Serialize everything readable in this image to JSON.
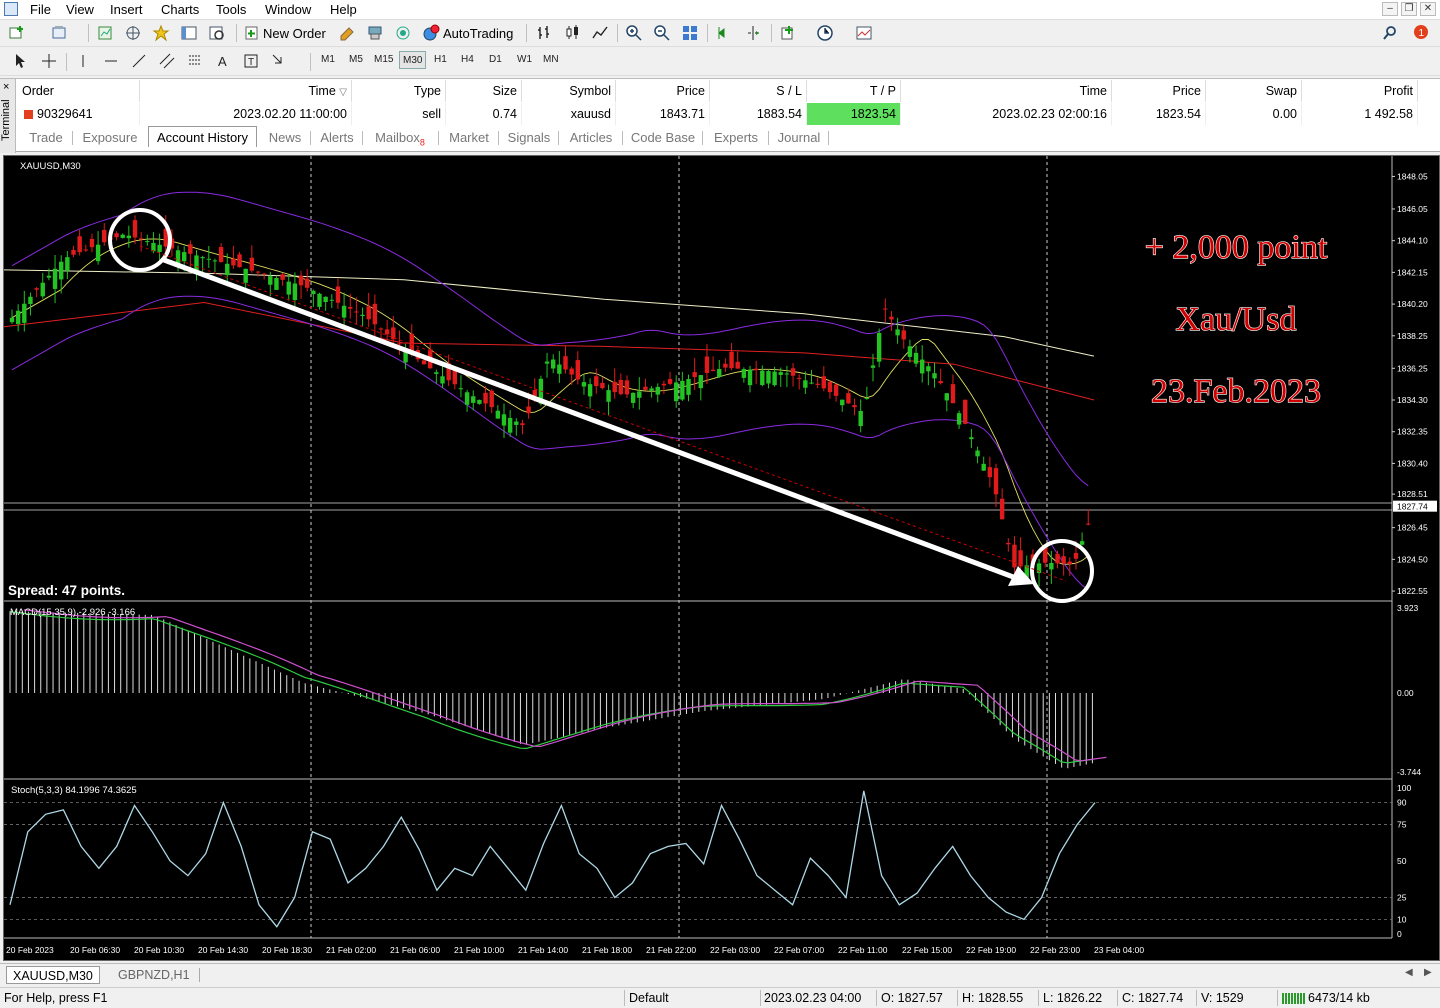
{
  "menu": [
    "File",
    "View",
    "Insert",
    "Charts",
    "Tools",
    "Window",
    "Help"
  ],
  "toolbar": {
    "new_order_label": "New Order",
    "autotrading_label": "AutoTrading"
  },
  "timeframes": [
    "M1",
    "M5",
    "M15",
    "M30",
    "H1",
    "H4",
    "D1",
    "W1",
    "MN"
  ],
  "active_timeframe": "M30",
  "terminal": {
    "side_label": "Terminal",
    "columns": [
      "Order",
      "Time",
      "Type",
      "Size",
      "Symbol",
      "Price",
      "S / L",
      "T / P",
      "Time",
      "Price",
      "Swap",
      "Profit"
    ],
    "row": [
      "90329641",
      "2023.02.20 11:00:00",
      "sell",
      "0.74",
      "xauusd",
      "1843.71",
      "1883.54",
      "1823.54",
      "2023.02.23 02:00:16",
      "1823.54",
      "0.00",
      "1 492.58"
    ],
    "tabs": [
      "Trade",
      "Exposure",
      "Account History",
      "News",
      "Alerts",
      "Mailbox",
      "Market",
      "Signals",
      "Articles",
      "Code Base",
      "Experts",
      "Journal"
    ],
    "active_tab": "Account History",
    "mailbox_badge": "8"
  },
  "chart": {
    "symbol_label": "XAUUSD,M30",
    "spread_label": "Spread: 47 points.",
    "annotation_lines": [
      "+ 2,000 point",
      "Xau/Usd",
      "23.Feb.2023"
    ],
    "annotation_color": "#d10000",
    "price_ticks": [
      "1848.05",
      "1846.05",
      "1844.10",
      "1842.15",
      "1840.20",
      "1838.25",
      "1836.25",
      "1834.30",
      "1832.35",
      "1830.40",
      "1828.51",
      "1827.74",
      "1826.45",
      "1824.50",
      "1822.55"
    ],
    "current_price": "1827.74",
    "macd_label": "MACD(15,35,9) -2.926 -3.166",
    "macd_ticks": [
      "3.923",
      "0.00",
      "-3.744"
    ],
    "stoch_label": "Stoch(5,3,3) 84.1996 74.3625",
    "stoch_ticks": [
      "100",
      "90",
      "75",
      "50",
      "25",
      "10",
      "0"
    ],
    "time_labels": [
      "20 Feb 2023",
      "20 Feb 06:30",
      "20 Feb 10:30",
      "20 Feb 14:30",
      "20 Feb 18:30",
      "21 Feb 02:00",
      "21 Feb 06:00",
      "21 Feb 10:00",
      "21 Feb 14:00",
      "21 Feb 18:00",
      "21 Feb 22:00",
      "22 Feb 03:00",
      "22 Feb 07:00",
      "22 Feb 11:00",
      "22 Feb 15:00",
      "22 Feb 19:00",
      "22 Feb 23:00",
      "23 Feb 04:00"
    ],
    "bull_color": "#22c322",
    "bear_color": "#e11b1b"
  },
  "chart_tabs": [
    "XAUUSD,M30",
    "GBPNZD,H1"
  ],
  "active_chart_tab": "XAUUSD,M30",
  "status": {
    "help": "For Help, press F1",
    "profile": "Default",
    "datetime": "2023.02.23 04:00",
    "open": "O: 1827.57",
    "high": "H: 1828.55",
    "low": "L: 1826.22",
    "close": "C: 1827.74",
    "volume": "V: 1529",
    "traffic": "6473/14 kb"
  }
}
